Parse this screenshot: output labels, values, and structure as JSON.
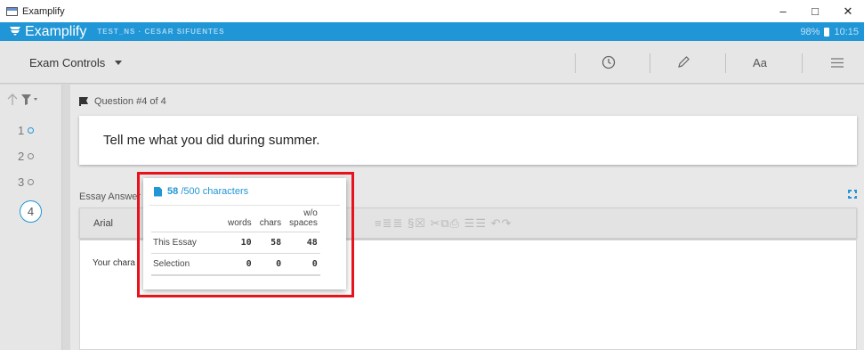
{
  "window": {
    "title": "Examplify",
    "controls": {
      "minimize": "–",
      "maximize": "□",
      "close": "✕"
    }
  },
  "appbar": {
    "name": "Examplify",
    "session": "TEST_NS · CESAR SIFUENTES",
    "battery": "98%",
    "time": "10:15",
    "color": "#2196d6"
  },
  "toolbar": {
    "exam_controls": "Exam Controls",
    "font_size_button": "Aa",
    "icons": [
      "clock-icon",
      "pen-icon",
      "font-size-icon",
      "menu-icon"
    ]
  },
  "nav": {
    "questions": [
      "1",
      "2",
      "3"
    ],
    "current": "4"
  },
  "question": {
    "header": "Question #4 of 4",
    "text": "Tell me what you did during summer."
  },
  "essay": {
    "label": "Essay Answer",
    "font": "Arial",
    "format_icons": "≡≣≣  §☒  ✂⧉⎙  ☰☰  ↶↷",
    "body": "Your chara"
  },
  "char_popup": {
    "count": "58",
    "limit": "/500 characters",
    "columns": [
      "words",
      "chars",
      "w/o spaces"
    ],
    "rows": [
      {
        "label": "This Essay",
        "values": [
          "10",
          "58",
          "48"
        ]
      },
      {
        "label": "Selection",
        "values": [
          "0",
          "0",
          "0"
        ]
      }
    ]
  }
}
